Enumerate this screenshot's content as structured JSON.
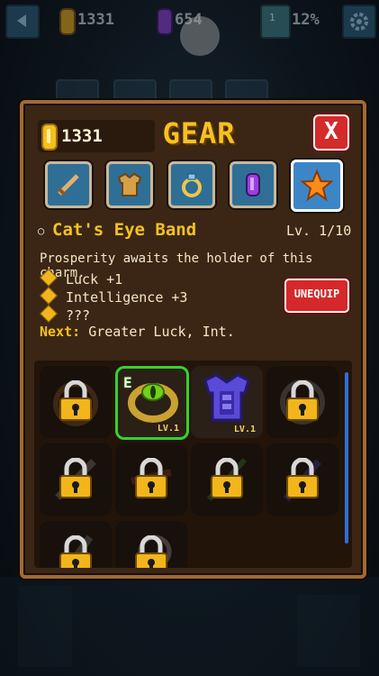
{
  "hud": {
    "gold": "1331",
    "gems": "654",
    "level_badge": "1",
    "percent": "12%"
  },
  "modal": {
    "gold": "1331",
    "title": "GEAR",
    "close": "X"
  },
  "tabs": [
    {
      "name": "weapon",
      "active": false
    },
    {
      "name": "armor",
      "active": false
    },
    {
      "name": "ring",
      "active": false
    },
    {
      "name": "gem",
      "active": false
    },
    {
      "name": "charm",
      "active": true
    }
  ],
  "item": {
    "name": "Cat's Eye Band",
    "level": "Lv. 1/10",
    "description": "Prosperity awaits the holder of this charm.",
    "stats": [
      "Luck +1",
      "Intelligence +3",
      "???"
    ],
    "next_label": "Next:",
    "next_value": "Greater Luck, Int.",
    "unequip": "UNEQUIP"
  },
  "inventory": {
    "equipped_badge": "E",
    "slots": [
      {
        "state": "locked"
      },
      {
        "state": "equipped",
        "level": "LV.1"
      },
      {
        "state": "owned",
        "level": "LV.1"
      },
      {
        "state": "locked"
      },
      {
        "state": "locked"
      },
      {
        "state": "locked"
      },
      {
        "state": "locked"
      },
      {
        "state": "locked"
      },
      {
        "state": "locked"
      },
      {
        "state": "locked"
      }
    ]
  },
  "colors": {
    "accent_gold": "#f7c21f",
    "frame": "#a06a35",
    "close_red": "#d42a2a",
    "equipped_green": "#37d22c"
  }
}
